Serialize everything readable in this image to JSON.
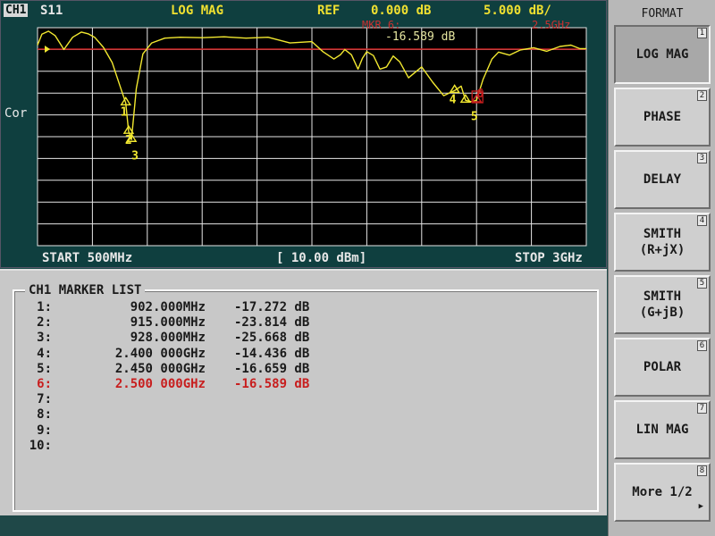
{
  "header": {
    "channel": "CH1",
    "parameter": "S11",
    "format": "LOG MAG",
    "ref_label": "REF",
    "ref_value": "0.000 dB",
    "scale": "5.000 dB/",
    "marker_label": "MKR 6:",
    "marker_value": "-16.589 dB",
    "marker_freq": "2.5GHz",
    "correction": "Cor"
  },
  "footer": {
    "start": "START 500MHz",
    "power": "[ 10.00 dBm]",
    "stop": "STOP 3GHz"
  },
  "colors": {
    "trace": "#f2e830",
    "reference_line": "#c81e1e",
    "active_marker": "#c81e1e",
    "grid": "#e6e6e6"
  },
  "chart_data": {
    "type": "line",
    "title": "LOG MAG",
    "xlabel": "",
    "ylabel": "",
    "xlim": [
      0.5,
      3.0
    ],
    "ylim": [
      -50,
      0
    ],
    "grid": true,
    "series": [
      {
        "x": [
          0.5,
          0.52,
          0.55,
          0.58,
          0.62,
          0.66,
          0.7,
          0.73,
          0.76,
          0.8,
          0.84,
          0.88,
          0.902,
          0.915,
          0.928,
          0.95,
          0.98,
          1.02,
          1.08,
          1.15,
          1.25,
          1.35,
          1.45,
          1.55,
          1.65,
          1.75,
          1.8,
          1.85,
          1.88,
          1.9,
          1.93,
          1.96,
          1.98,
          2.0,
          2.03,
          2.06,
          2.09,
          2.12,
          2.15,
          2.19,
          2.25,
          2.3,
          2.35,
          2.4,
          2.43,
          2.45,
          2.48,
          2.5,
          2.53,
          2.57,
          2.6,
          2.65,
          2.7,
          2.76,
          2.82,
          2.88,
          2.93,
          2.97,
          3.0
        ],
        "y": [
          -4.0,
          -1.5,
          -0.8,
          -1.8,
          -5.0,
          -2.2,
          -1.0,
          -1.4,
          -2.2,
          -4.5,
          -8.0,
          -14.0,
          -17.272,
          -23.814,
          -25.668,
          -14.0,
          -6.0,
          -3.5,
          -2.4,
          -2.2,
          -2.3,
          -2.1,
          -2.4,
          -2.2,
          -3.5,
          -3.2,
          -5.5,
          -7.2,
          -6.2,
          -5.0,
          -6.2,
          -9.5,
          -7.0,
          -5.5,
          -6.4,
          -9.5,
          -9.0,
          -6.5,
          -7.8,
          -11.5,
          -9.0,
          -12.5,
          -15.6,
          -14.436,
          -13.4,
          -16.659,
          -17.0,
          -16.589,
          -11.8,
          -7.2,
          -5.6,
          -6.3,
          -5.1,
          -4.6,
          -5.4,
          -4.3,
          -4.0,
          -4.8,
          -4.8
        ]
      }
    ],
    "markers": [
      {
        "id": "1",
        "x": 0.902,
        "y": -17.272
      },
      {
        "id": "2",
        "x": 0.915,
        "y": -23.814
      },
      {
        "id": "3",
        "x": 0.928,
        "y": -25.668
      },
      {
        "id": "4",
        "x": 2.4,
        "y": -14.436
      },
      {
        "id": "5",
        "x": 2.45,
        "y": -16.659
      },
      {
        "id": "6",
        "x": 2.5,
        "y": -16.589
      }
    ]
  },
  "marker_list": {
    "title": "CH1 MARKER LIST",
    "rows": [
      {
        "index": "1:",
        "freq": "902.000MHz",
        "value": "-17.272 dB",
        "active": false
      },
      {
        "index": "2:",
        "freq": "915.000MHz",
        "value": "-23.814 dB",
        "active": false
      },
      {
        "index": "3:",
        "freq": "928.000MHz",
        "value": "-25.668 dB",
        "active": false
      },
      {
        "index": "4:",
        "freq": "2.400 000GHz",
        "value": "-14.436 dB",
        "active": false
      },
      {
        "index": "5:",
        "freq": "2.450 000GHz",
        "value": "-16.659 dB",
        "active": false
      },
      {
        "index": "6:",
        "freq": "2.500 000GHz",
        "value": "-16.589 dB",
        "active": true
      },
      {
        "index": "7:",
        "freq": "",
        "value": "",
        "active": false
      },
      {
        "index": "8:",
        "freq": "",
        "value": "",
        "active": false
      },
      {
        "index": "9:",
        "freq": "",
        "value": "",
        "active": false
      },
      {
        "index": "10:",
        "freq": "",
        "value": "",
        "active": false
      }
    ]
  },
  "softkeys": {
    "title": "FORMAT",
    "keys": [
      {
        "label": "LOG MAG",
        "num": "1",
        "pressed": true
      },
      {
        "label": "PHASE",
        "num": "2",
        "pressed": false
      },
      {
        "label": "DELAY",
        "num": "3",
        "pressed": false
      },
      {
        "label": "SMITH\n(R+jX)",
        "num": "4",
        "pressed": false
      },
      {
        "label": "SMITH\n(G+jB)",
        "num": "5",
        "pressed": false
      },
      {
        "label": "POLAR",
        "num": "6",
        "pressed": false
      },
      {
        "label": "LIN MAG",
        "num": "7",
        "pressed": false
      },
      {
        "label": "More 1/2",
        "num": "8",
        "pressed": false
      }
    ],
    "more_icon": "triangle-right-icon"
  }
}
